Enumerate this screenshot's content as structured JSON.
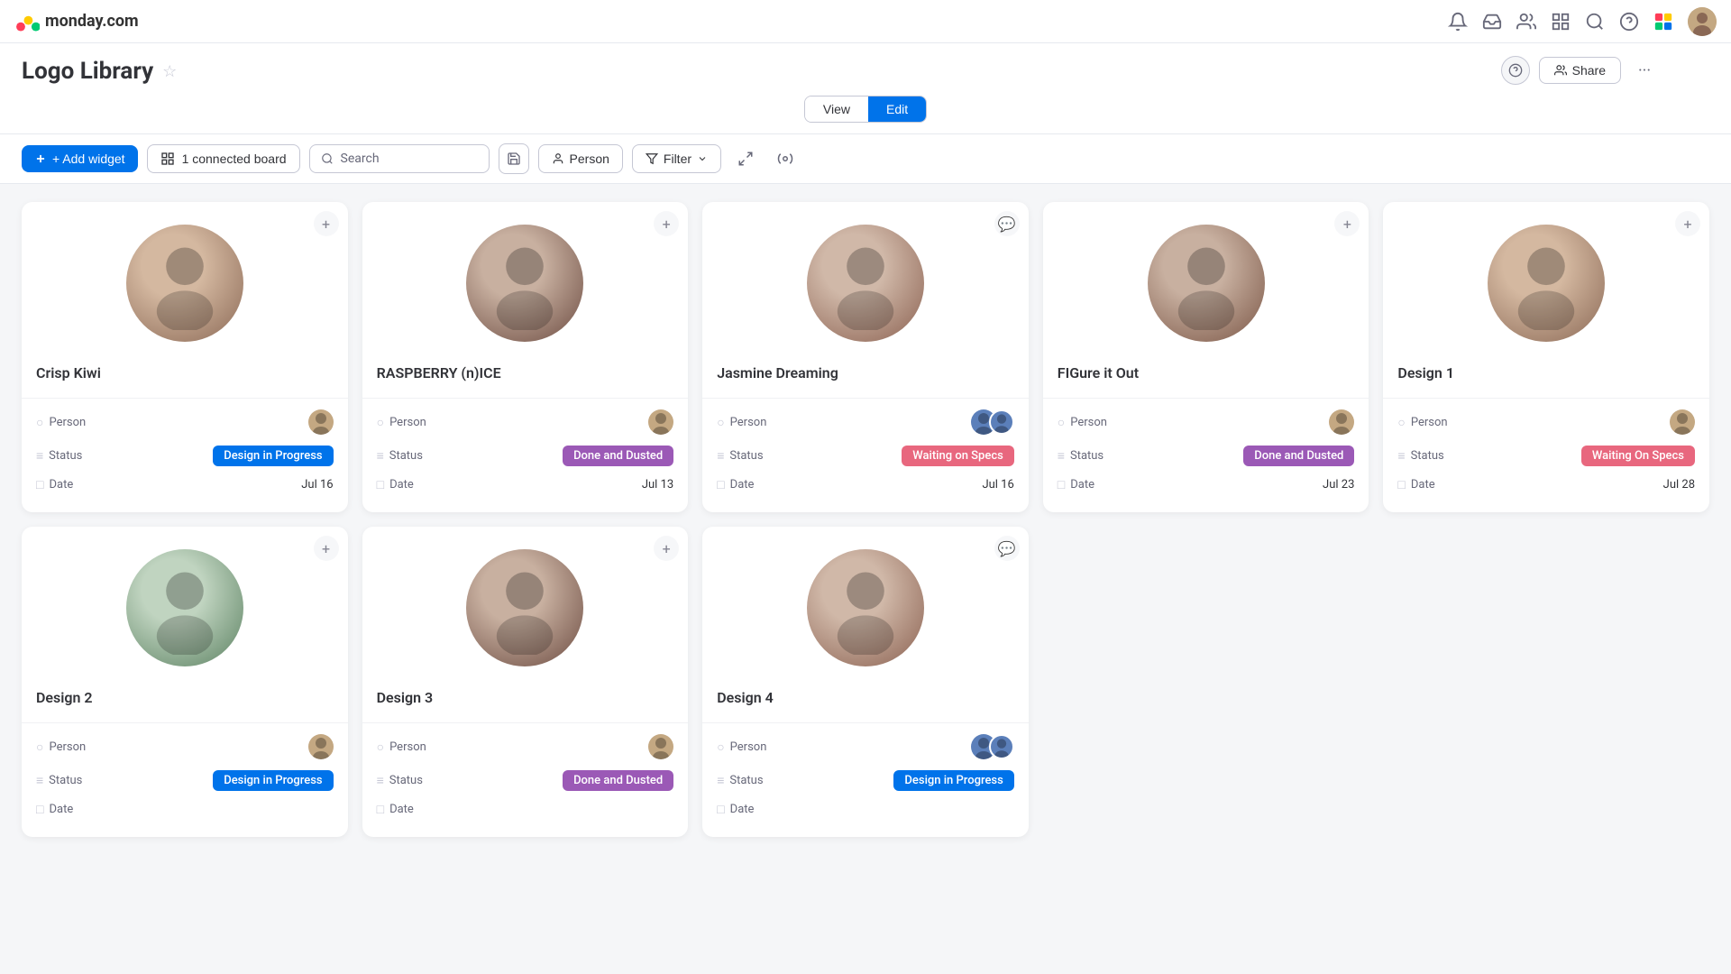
{
  "app": {
    "name": "monday.com"
  },
  "page": {
    "title": "Logo Library",
    "view_label": "View",
    "edit_label": "Edit"
  },
  "topnav": {
    "share_label": "Share",
    "help_label": "?",
    "more_label": "..."
  },
  "toolbar": {
    "add_widget_label": "+ Add widget",
    "connected_board_label": "1 connected board",
    "search_placeholder": "Search",
    "person_label": "Person",
    "filter_label": "Filter"
  },
  "cards": [
    {
      "id": "crisp-kiwi",
      "title": "Crisp Kiwi",
      "person_label": "Person",
      "status_label": "Status",
      "date_label": "Date",
      "status": "Design in Progress",
      "status_class": "status-design-progress",
      "date": "Jul 16",
      "photo_class": "photo-1",
      "avatar_class": "avatar-brown"
    },
    {
      "id": "raspberry-nice",
      "title": "RASPBERRY (n)ICE",
      "person_label": "Person",
      "status_label": "Status",
      "date_label": "Date",
      "status": "Done and Dusted",
      "status_class": "status-done-dusted",
      "date": "Jul 13",
      "photo_class": "photo-2",
      "avatar_class": "avatar-brown"
    },
    {
      "id": "jasmine-dreaming",
      "title": "Jasmine Dreaming",
      "person_label": "Person",
      "status_label": "Status",
      "date_label": "Date",
      "status": "Waiting on Specs",
      "status_class": "status-waiting-specs",
      "date": "Jul 16",
      "photo_class": "photo-jasmine",
      "avatar_class": "avatar-teal",
      "has_pair": true
    },
    {
      "id": "figure-it-out",
      "title": "FIGure it Out",
      "person_label": "Person",
      "status_label": "Status",
      "date_label": "Date",
      "status": "Done and Dusted",
      "status_class": "status-done-dusted",
      "date": "Jul 23",
      "photo_class": "photo-figout",
      "avatar_class": "avatar-brown"
    },
    {
      "id": "design-1",
      "title": "Design 1",
      "person_label": "Person",
      "status_label": "Status",
      "date_label": "Date",
      "status": "Waiting On Specs",
      "status_class": "status-waiting-specs",
      "date": "Jul 28",
      "photo_class": "photo-design1",
      "avatar_class": "avatar-brown"
    },
    {
      "id": "design-2",
      "title": "Design 2",
      "person_label": "Person",
      "status_label": "Status",
      "date_label": "Date",
      "status": "Design in Progress",
      "status_class": "status-design-progress",
      "date": "",
      "photo_class": "photo-design2",
      "avatar_class": "avatar-brown"
    },
    {
      "id": "design-3",
      "title": "Design 3",
      "person_label": "Person",
      "status_label": "Status",
      "date_label": "Date",
      "status": "Done and Dusted",
      "status_class": "status-done-dusted",
      "date": "",
      "photo_class": "photo-design3",
      "avatar_class": "avatar-brown"
    },
    {
      "id": "design-4",
      "title": "Design 4",
      "person_label": "Person",
      "status_label": "Status",
      "date_label": "Date",
      "status": "Design in Progress",
      "status_class": "status-design-progress",
      "date": "",
      "photo_class": "photo-design4",
      "avatar_class": "avatar-teal",
      "has_pair": true
    }
  ]
}
